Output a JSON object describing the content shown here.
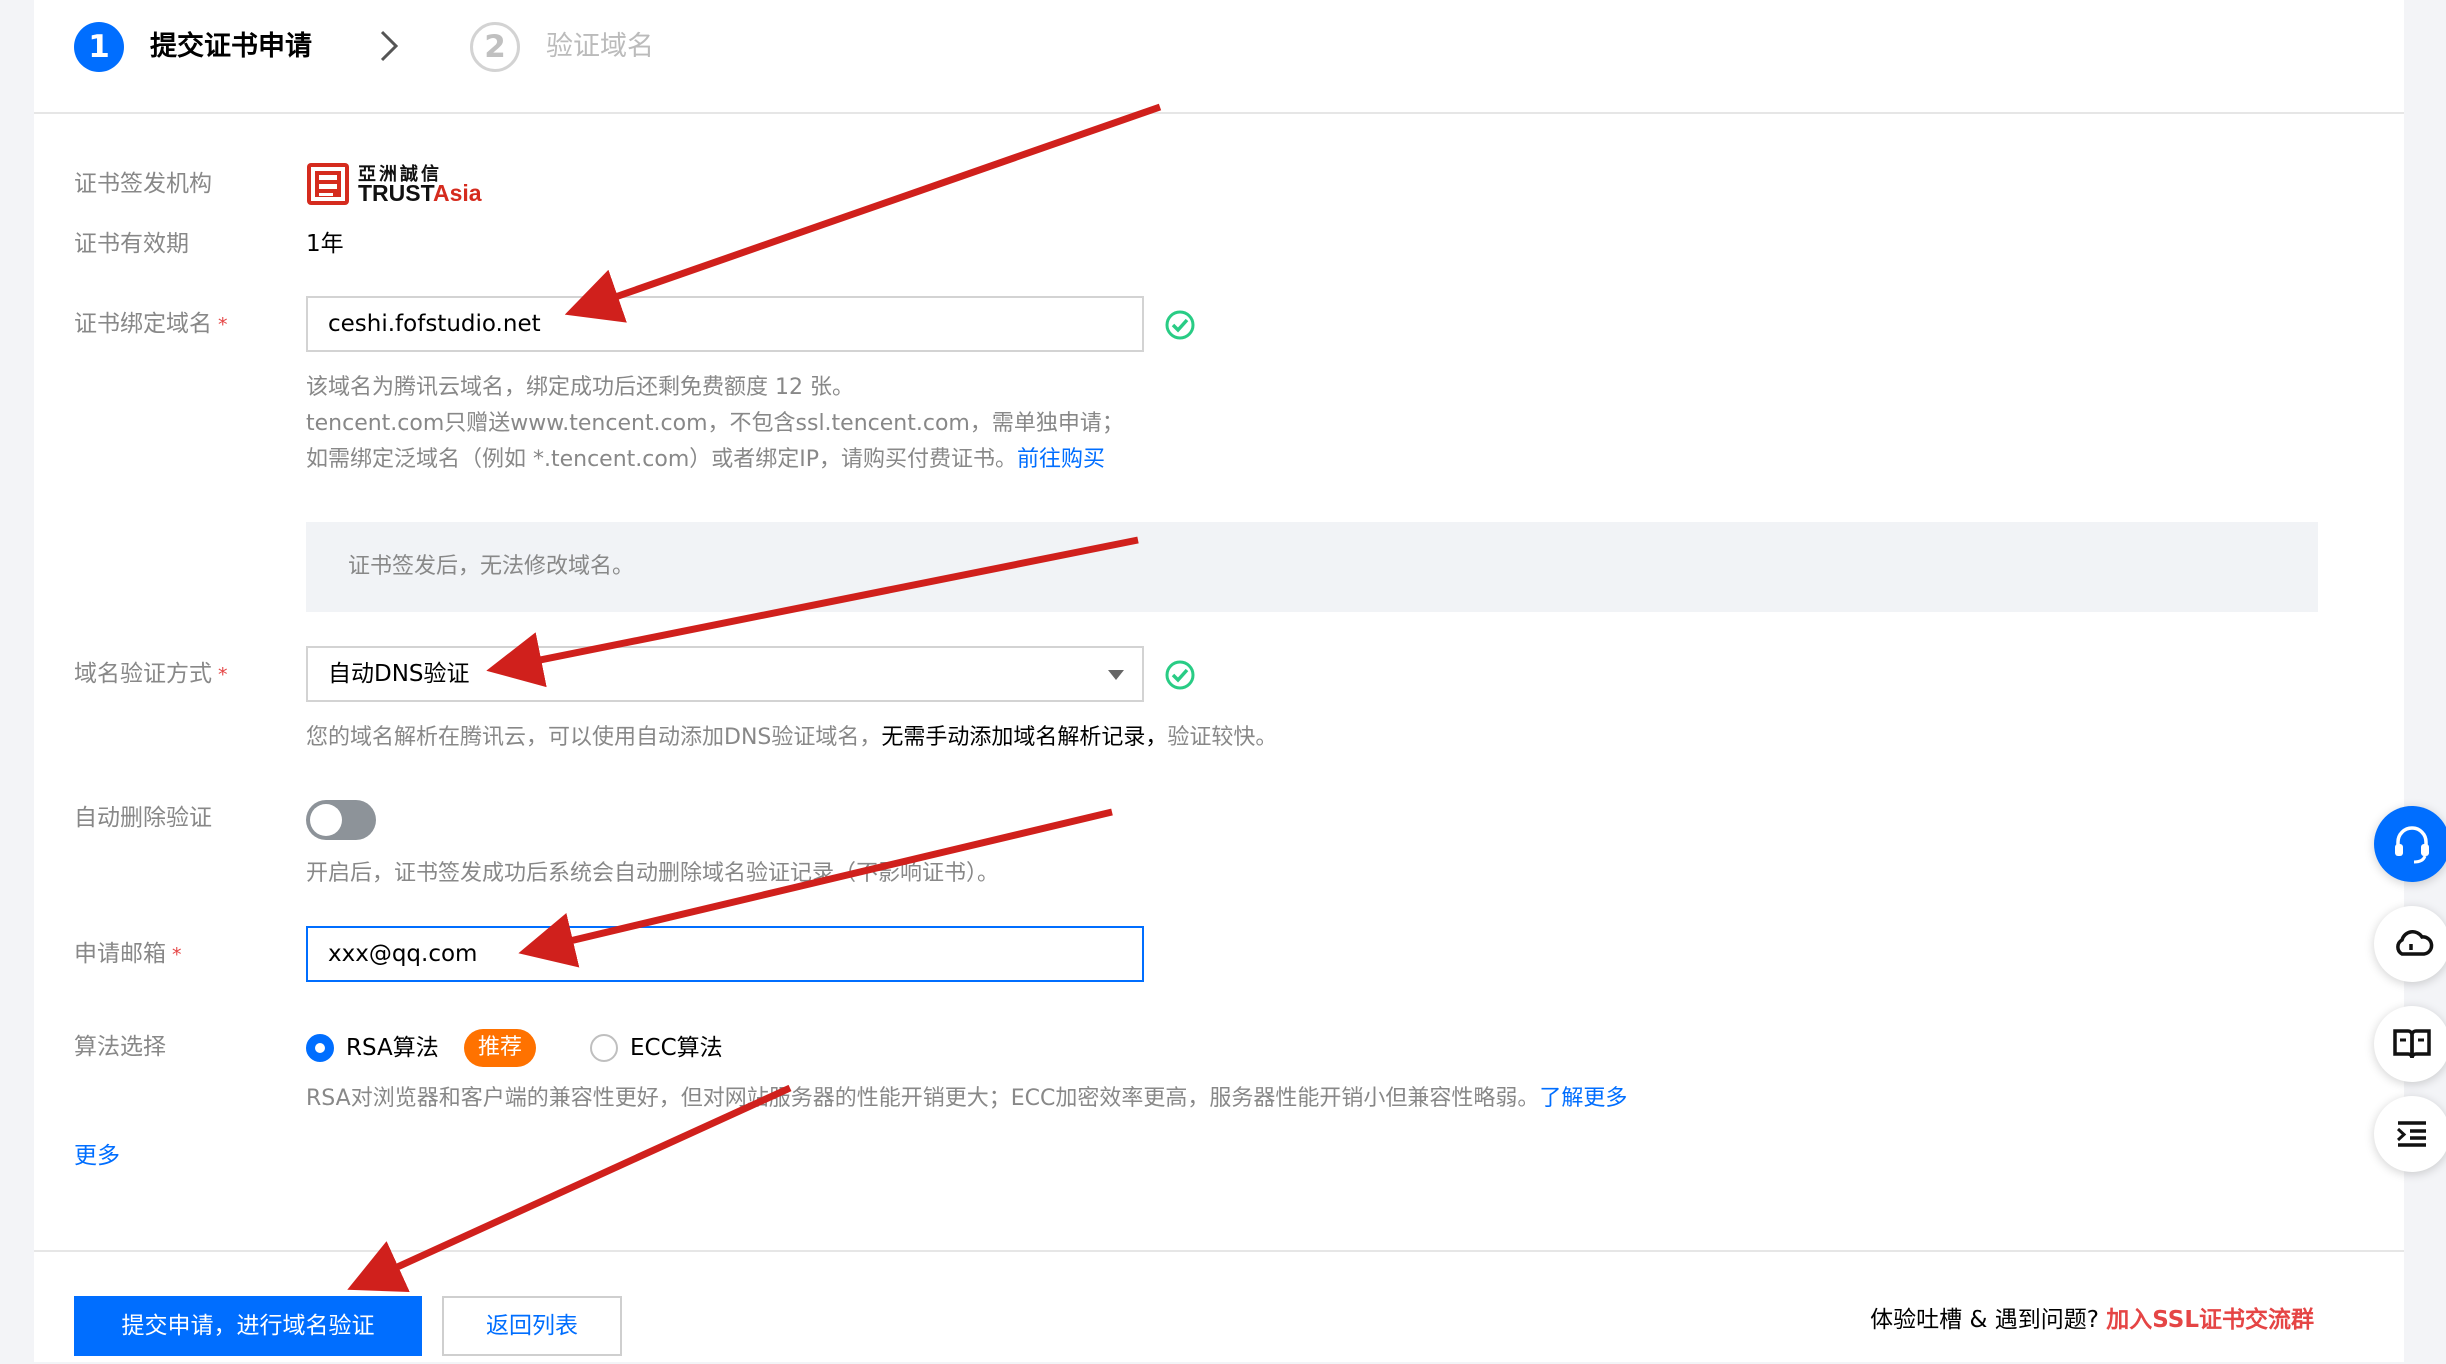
{
  "steps": [
    {
      "number": "1",
      "label": "提交证书申请"
    },
    {
      "number": "2",
      "label": "验证域名"
    }
  ],
  "issuer": {
    "label": "证书签发机构",
    "logo_cn": "亞洲誠信",
    "logo_en_a": "TRUST",
    "logo_en_b": "Asia"
  },
  "validity": {
    "label": "证书有效期",
    "value": "1年"
  },
  "domain": {
    "label": "证书绑定域名",
    "value": "ceshi.fofstudio.net",
    "hint1": "该域名为腾讯云域名，绑定成功后还剩免费额度 12 张。",
    "hint2": "tencent.com只赠送www.tencent.com，不包含ssl.tencent.com，需单独申请；",
    "hint3": "如需绑定泛域名（例如 *.tencent.com）或者绑定IP，请购买付费证书。",
    "hint3_link": "前往购买"
  },
  "notice": "证书签发后，无法修改域名。",
  "verify_method": {
    "label": "域名验证方式",
    "value": "自动DNS验证",
    "hint_a": "您的域名解析在腾讯云，可以使用自动添加DNS验证域名，",
    "hint_b": "无需手动添加域名解析记录，",
    "hint_c": "验证较快。"
  },
  "auto_delete": {
    "label": "自动删除验证",
    "enabled": false,
    "hint": "开启后，证书签发成功后系统会自动删除域名验证记录（不影响证书）。"
  },
  "email": {
    "label": "申请邮箱",
    "value": "xxx@qq.com"
  },
  "algorithm": {
    "label": "算法选择",
    "options": [
      {
        "label": "RSA算法",
        "selected": true
      },
      {
        "label": "ECC算法",
        "selected": false
      }
    ],
    "badge": "推荐",
    "hint": "RSA对浏览器和客户端的兼容性更好，但对网站服务器的性能开销更大；ECC加密效率更高，服务器性能开销小但兼容性略弱。",
    "hint_link": "了解更多"
  },
  "more_link": "更多",
  "footer": {
    "submit": "提交申请，进行域名验证",
    "back": "返回列表",
    "feedback": "体验吐槽 & 遇到问题? ",
    "feedback_link": "加入SSL证书交流群"
  },
  "floating_buttons": [
    "headset-icon",
    "cloud-bell-icon",
    "book-icon",
    "list-indent-icon"
  ],
  "colors": {
    "primary": "#006eff",
    "danger": "#e54545",
    "badge": "#ff7200",
    "success": "#29cc85",
    "annotation_arrow": "#d0201c"
  }
}
